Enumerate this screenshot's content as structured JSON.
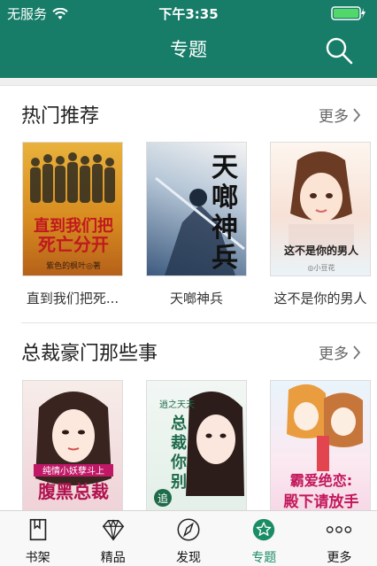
{
  "status_bar": {
    "carrier": "无服务",
    "time": "下午3:35"
  },
  "header": {
    "title": "专题"
  },
  "colors": {
    "header": "#177d68",
    "active_tab": "#1a8d65"
  },
  "sections": [
    {
      "title": "热门推荐",
      "more_label": "更多",
      "books": [
        {
          "title": "直到我们把死...",
          "cover_text": "直到我们把死亡分开",
          "cover_sub": "紫色的枫叶◎著"
        },
        {
          "title": "天啷神兵",
          "cover_text": "天啷神兵",
          "cover_sub": ""
        },
        {
          "title": "这不是你的男人",
          "cover_text": "这不是你的男人",
          "cover_sub": "小豆花"
        }
      ]
    },
    {
      "title": "总裁豪门那些事",
      "more_label": "更多",
      "books": [
        {
          "title": "",
          "cover_text": "腹黑总裁",
          "cover_sub": "纯情小妖孽斗上"
        },
        {
          "title": "",
          "cover_text": "总裁你别追",
          "cover_sub": "逍之天天"
        },
        {
          "title": "",
          "cover_text": "霸爱绝恋殿下请放手",
          "cover_sub": ""
        }
      ]
    }
  ],
  "tabs": [
    {
      "label": "书架",
      "icon": "bookshelf-icon",
      "active": false
    },
    {
      "label": "精品",
      "icon": "diamond-icon",
      "active": false
    },
    {
      "label": "发现",
      "icon": "compass-icon",
      "active": false
    },
    {
      "label": "专题",
      "icon": "star-icon",
      "active": true
    },
    {
      "label": "更多",
      "icon": "more-dots-icon",
      "active": false
    }
  ]
}
